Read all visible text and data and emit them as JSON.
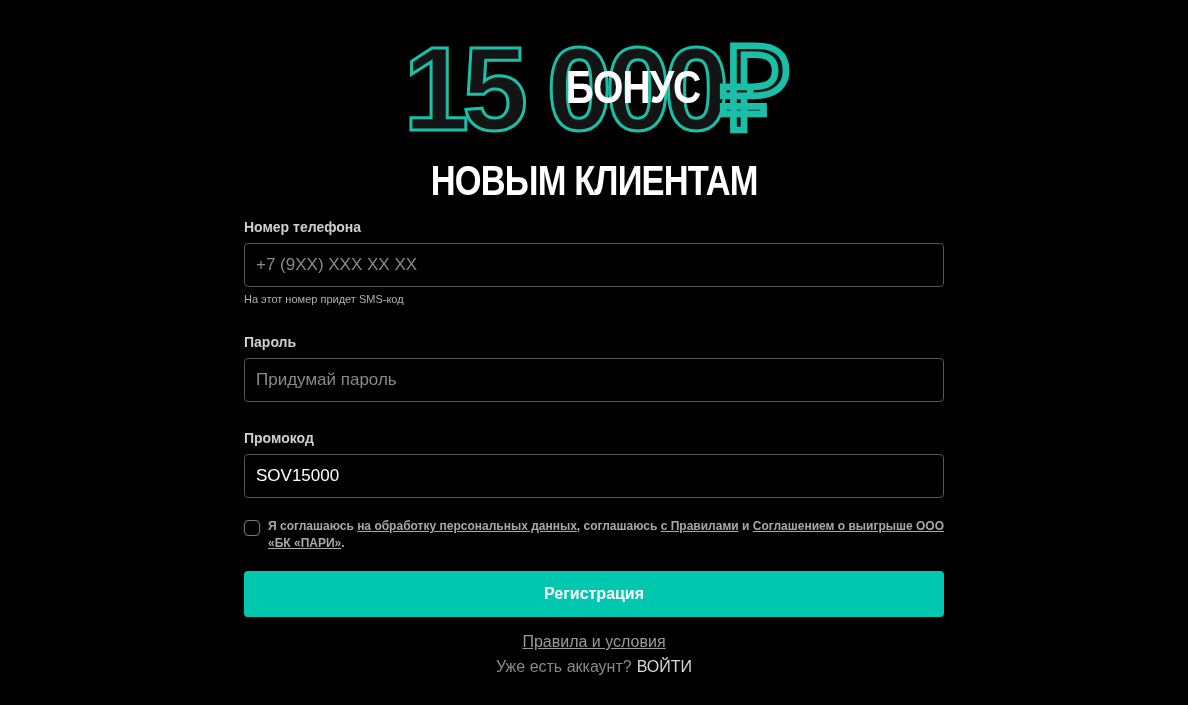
{
  "banner": {
    "amount": "15 000₽",
    "badge": "БОНУС",
    "subtitle": "НОВЫМ КЛИЕНТАМ"
  },
  "fields": [
    {
      "label": "Номер телефона",
      "placeholder": "+7 (9XX) XXX XX XX",
      "hint": "На этот номер придет SMS-код"
    },
    {
      "label": "Пароль",
      "placeholder": "Придумай пароль"
    },
    {
      "label": "Промокод",
      "value": "SOV15000"
    }
  ],
  "consent": {
    "checked": false,
    "parts": [
      {
        "kind": "text",
        "text": "Я соглашаюсь"
      },
      {
        "kind": "link",
        "text": "на обработку персональных данных"
      },
      {
        "kind": "text",
        "text": ", соглашаюсь"
      },
      {
        "kind": "link",
        "text": "с Правилами"
      },
      {
        "kind": "text",
        "text": "и"
      },
      {
        "kind": "link",
        "text": "Соглашением о выигрыше ООО"
      },
      {
        "kind": "link",
        "text": "«БК «ПАРИ»"
      },
      {
        "kind": "text",
        "text": "."
      }
    ]
  },
  "submit": "Регистрация",
  "terms_link": "Правила и условия",
  "login": {
    "question": "Уже есть аккаунт?",
    "link": "ВОЙТИ"
  }
}
